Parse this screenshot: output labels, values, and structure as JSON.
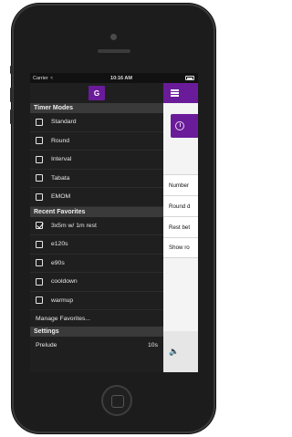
{
  "status_bar": {
    "carrier": "Carrier",
    "wifi": "wifi-icon",
    "time": "10:16 AM"
  },
  "drawer": {
    "logo": "G",
    "timer_modes": {
      "header": "Timer Modes",
      "items": [
        {
          "label": "Standard",
          "checked": false
        },
        {
          "label": "Round",
          "checked": false
        },
        {
          "label": "Interval",
          "checked": false
        },
        {
          "label": "Tabata",
          "checked": false
        },
        {
          "label": "EMOM",
          "checked": false
        }
      ]
    },
    "recent_favorites": {
      "header": "Recent Favorites",
      "items": [
        {
          "label": "3x5m w/ 1m rest",
          "checked": true
        },
        {
          "label": "e120s",
          "checked": false
        },
        {
          "label": "e90s",
          "checked": false
        },
        {
          "label": "cooldown",
          "checked": false
        },
        {
          "label": "warmup",
          "checked": false
        }
      ],
      "manage_label": "Manage Favorites..."
    },
    "settings": {
      "header": "Settings",
      "prelude_label": "Prelude",
      "prelude_value": "10s"
    }
  },
  "main": {
    "menu_icon": "hamburger-icon",
    "clock_icon": "clock-icon",
    "rows": [
      "Number",
      "Round d",
      "Rest bet",
      "Show ro"
    ]
  },
  "colors": {
    "accent": "#6a1b9a",
    "drawer_bg": "#1f1f1f",
    "section_bg": "#3a3a3a"
  }
}
